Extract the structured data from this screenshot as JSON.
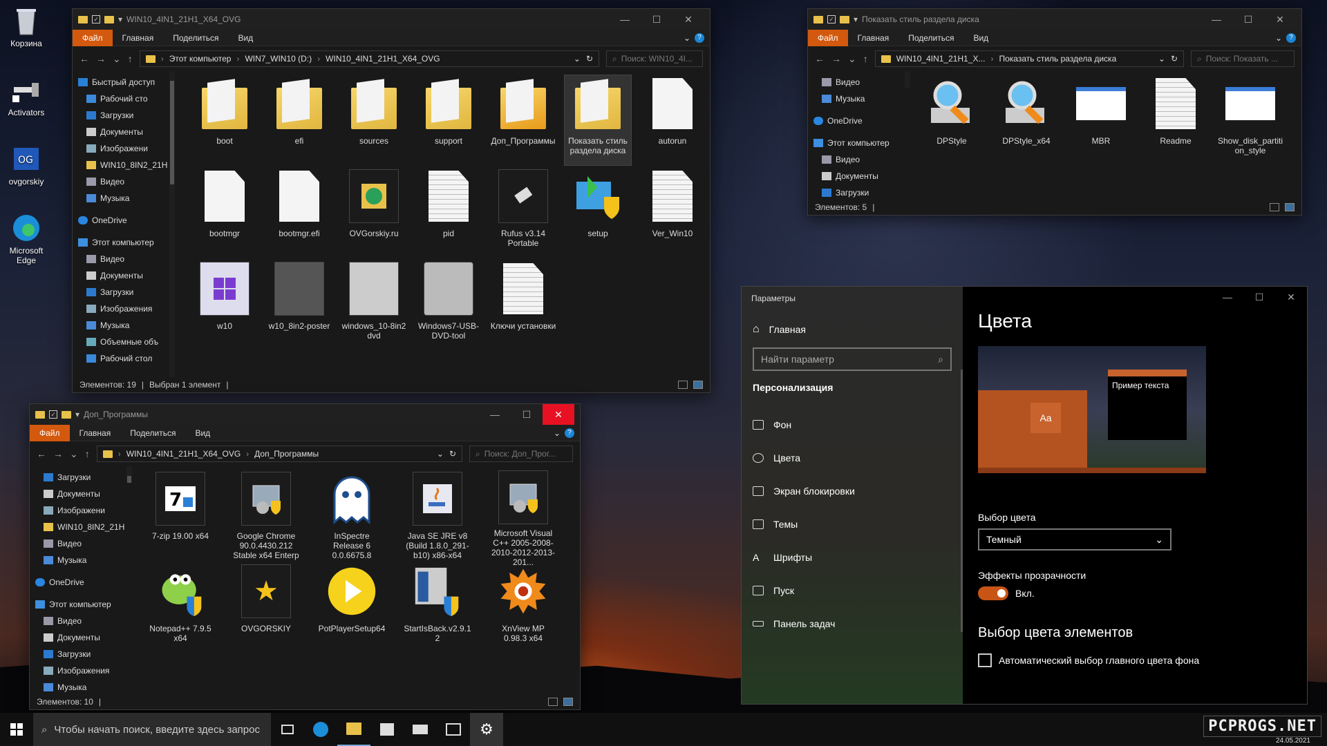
{
  "desktop": {
    "icons": [
      "Корзина",
      "Activators",
      "ovgorskiy",
      "Microsoft Edge"
    ]
  },
  "w1": {
    "title": "WIN10_4IN1_21H1_X64_OVG",
    "ribbon": [
      "Файл",
      "Главная",
      "Поделиться",
      "Вид"
    ],
    "path": [
      "Этот компьютер",
      "WIN7_WIN10 (D:)",
      "WIN10_4IN1_21H1_X64_OVG"
    ],
    "search": "Поиск: WIN10_4I...",
    "side": [
      "Быстрый доступ",
      "Рабочий сто",
      "Загрузки",
      "Документы",
      "Изображени",
      "WIN10_8IN2_21H",
      "Видео",
      "Музыка",
      "OneDrive",
      "Этот компьютер",
      "Видео",
      "Документы",
      "Загрузки",
      "Изображения",
      "Музыка",
      "Объемные объ",
      "Рабочий стол"
    ],
    "items": [
      "boot",
      "efi",
      "sources",
      "support",
      "Доп_Программы",
      "Показать стиль раздела диска",
      "autorun",
      "bootmgr",
      "bootmgr.efi",
      "OVGorskiy.ru",
      "pid",
      "Rufus v3.14 Portable",
      "setup",
      "Ver_Win10",
      "w10",
      "w10_8in2-poster",
      "windows_10-8in2 dvd",
      "Windows7-USB-DVD-tool",
      "Ключи установки"
    ],
    "status": [
      "Элементов: 19",
      "Выбран 1 элемент"
    ]
  },
  "w2": {
    "title": "Показать стиль раздела диска",
    "ribbon": [
      "Файл",
      "Главная",
      "Поделиться",
      "Вид"
    ],
    "path": [
      "WIN10_4IN1_21H1_X...",
      "Показать стиль раздела диска"
    ],
    "search": "Поиск: Показать ...",
    "side": [
      "Видео",
      "Музыка",
      "OneDrive",
      "Этот компьютер",
      "Видео",
      "Документы",
      "Загрузки"
    ],
    "items": [
      "DPStyle",
      "DPStyle_x64",
      "MBR",
      "Readme",
      "Show_disk_partition_style"
    ],
    "status": "Элементов: 5"
  },
  "w3": {
    "title": "Доп_Программы",
    "ribbon": [
      "Файл",
      "Главная",
      "Поделиться",
      "Вид"
    ],
    "path": [
      "WIN10_4IN1_21H1_X64_OVG",
      "Доп_Программы"
    ],
    "search": "Поиск: Доп_Прог...",
    "side": [
      "Загрузки",
      "Документы",
      "Изображени",
      "WIN10_8IN2_21H",
      "Видео",
      "Музыка",
      "OneDrive",
      "Этот компьютер",
      "Видео",
      "Документы",
      "Загрузки",
      "Изображения",
      "Музыка"
    ],
    "items": [
      "7-zip 19.00 x64",
      "Google Chrome 90.0.4430.212 Stable x64 Enterp",
      "InSpectre Release 6 0.0.6675.8",
      "Java SE JRE v8 (Build 1.8.0_291-b10) x86-x64",
      "Microsoft Visual C++ 2005-2008-2010-2012-2013-201...",
      "Notepad++ 7.9.5 x64",
      "OVGORSKIY",
      "PotPlayerSetup64",
      "StartIsBack.v2.9.1 2",
      "XnView MP 0.98.3 x64"
    ],
    "status": "Элементов: 10"
  },
  "settings": {
    "title": "Параметры",
    "home": "Главная",
    "search": "Найти параметр",
    "section": "Персонализация",
    "nav": [
      "Фон",
      "Цвета",
      "Экран блокировки",
      "Темы",
      "Шрифты",
      "Пуск",
      "Панель задач"
    ],
    "heading": "Цвета",
    "preview_text": "Пример текста",
    "preview_aa": "Aa",
    "color_label": "Выбор цвета",
    "color_value": "Темный",
    "transp_label": "Эффекты прозрачности",
    "transp_value": "Вкл.",
    "accent_heading": "Выбор цвета элементов",
    "auto_label": "Автоматический выбор главного цвета фона",
    "accent": "#c85516"
  },
  "taskbar": {
    "search": "Чтобы начать поиск, введите здесь запрос",
    "watermark": "PCPROGS.NET",
    "date": "24.05.2021"
  }
}
